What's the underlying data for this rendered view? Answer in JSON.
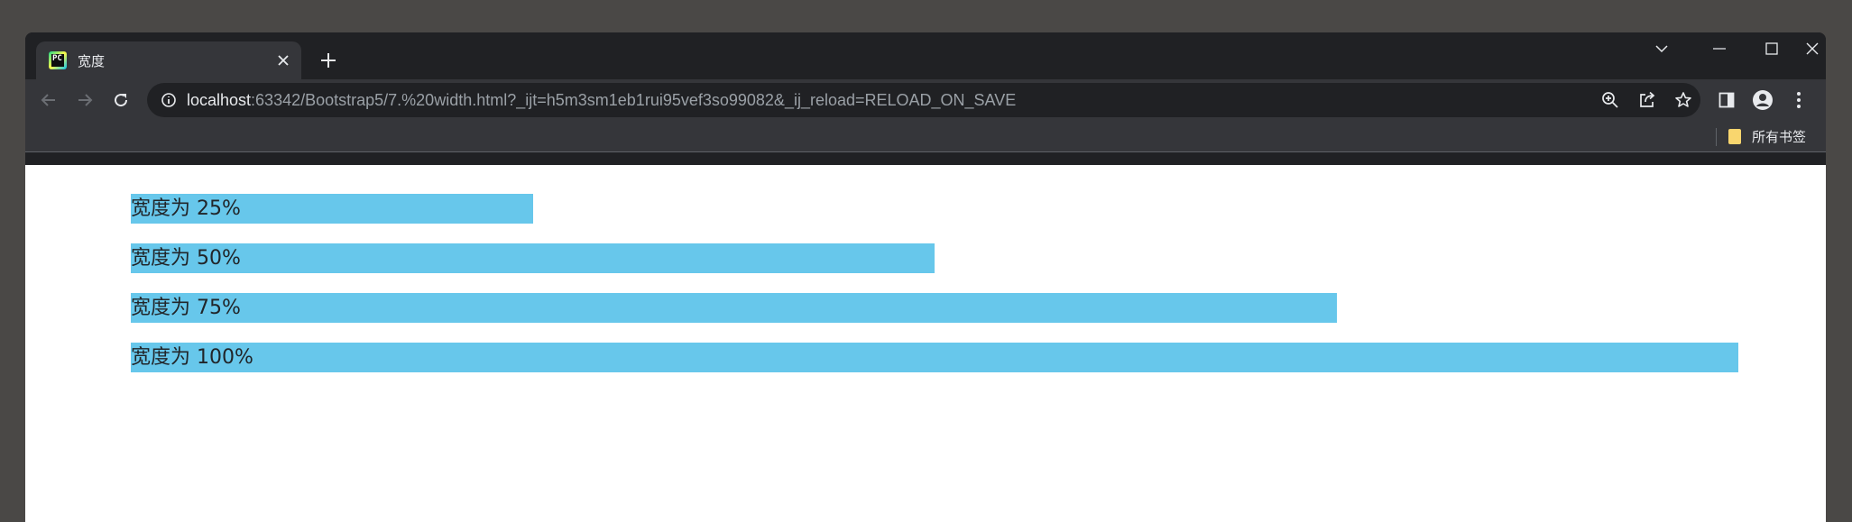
{
  "browser": {
    "tab": {
      "title": "宽度",
      "favicon_text": "PC"
    },
    "address": {
      "host": "localhost",
      "rest": ":63342/Bootstrap5/7.%20width.html?_ijt=h5m3sm1eb1rui95vef3so99082&_ij_reload=RELOAD_ON_SAVE"
    },
    "bookmarks": {
      "all_bookmarks_label": "所有书签"
    }
  },
  "page": {
    "bars": [
      {
        "label": "宽度为 25%",
        "width_percent": 25
      },
      {
        "label": "宽度为 50%",
        "width_percent": 50
      },
      {
        "label": "宽度为 75%",
        "width_percent": 75
      },
      {
        "label": "宽度为 100%",
        "width_percent": 100
      }
    ]
  },
  "colors": {
    "bar_bg": "#67c7eb",
    "chrome_dark": "#202124",
    "chrome_toolbar": "#35363a"
  },
  "icons": [
    "back-icon",
    "forward-icon",
    "reload-icon",
    "info-icon",
    "zoom-icon",
    "share-icon",
    "star-icon",
    "side-panel-icon",
    "profile-icon",
    "more-icon",
    "close-icon",
    "plus-icon",
    "chevron-down-icon",
    "minimize-icon",
    "maximize-icon",
    "window-close-icon",
    "folder-icon"
  ]
}
